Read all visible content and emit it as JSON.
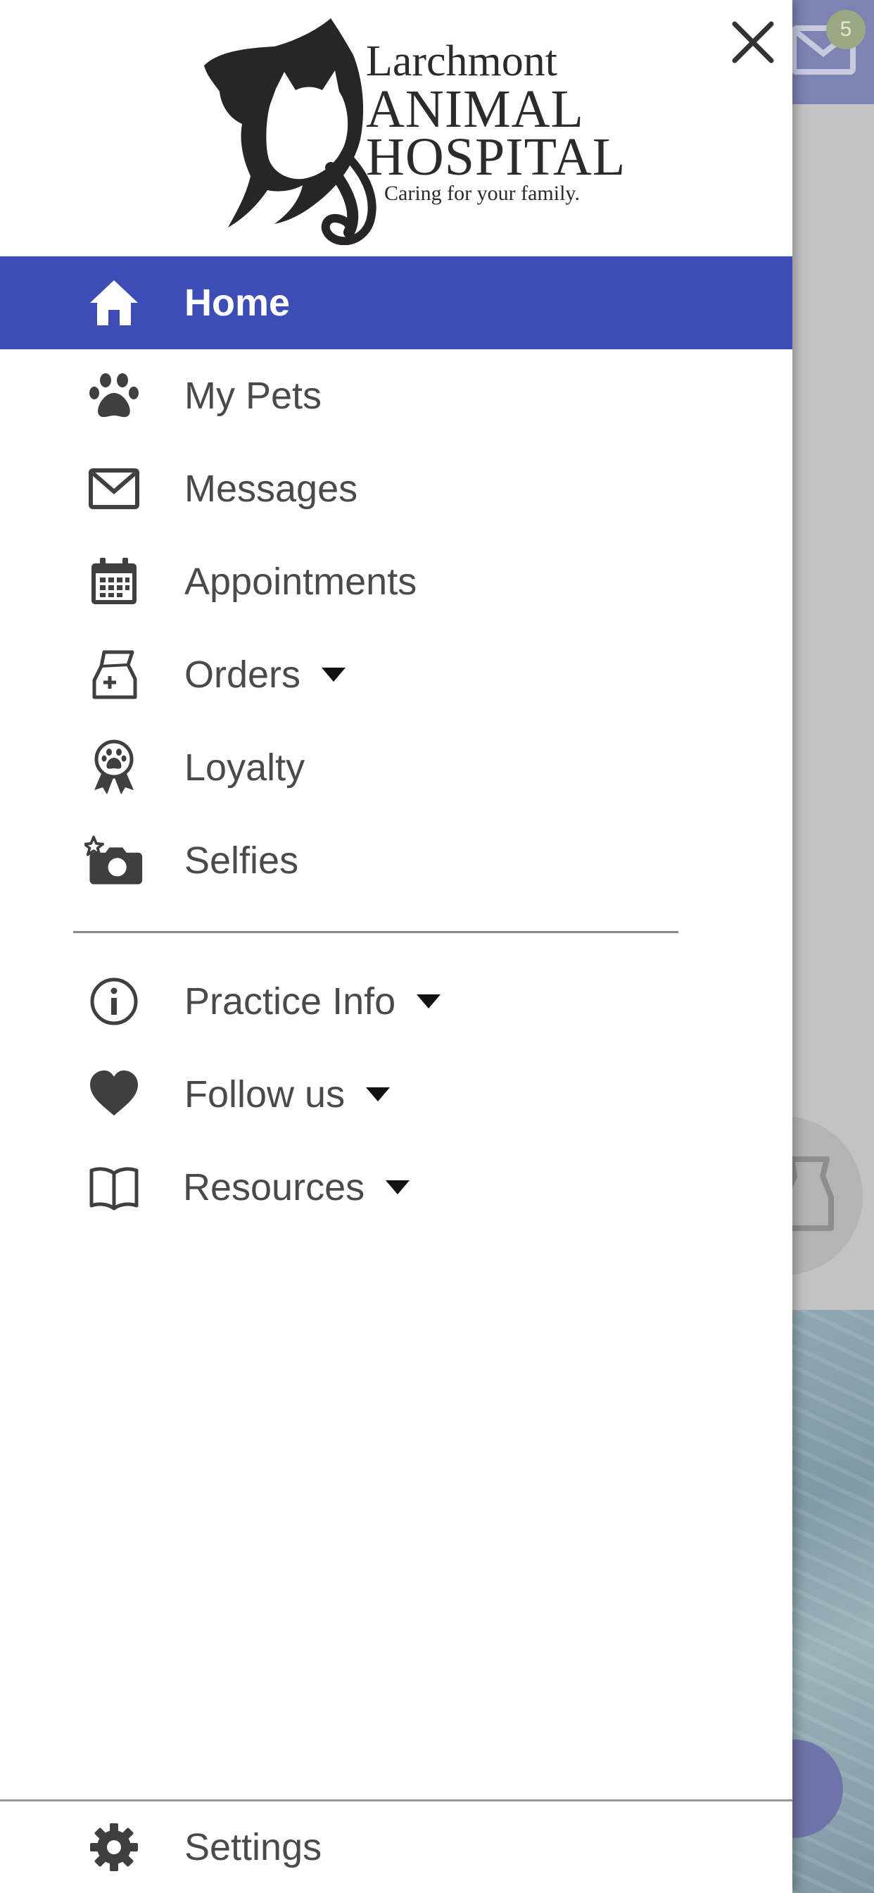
{
  "background": {
    "unread_badge": "5"
  },
  "drawer": {
    "logo": {
      "line1": "Larchmont",
      "line2": "ANIMAL",
      "line3": "HOSPITAL",
      "tagline": "Caring for your family."
    },
    "items": [
      {
        "label": "Home",
        "icon": "home-icon",
        "active": true
      },
      {
        "label": "My Pets",
        "icon": "paw-icon"
      },
      {
        "label": "Messages",
        "icon": "envelope-icon"
      },
      {
        "label": "Appointments",
        "icon": "calendar-icon"
      },
      {
        "label": "Orders",
        "icon": "medicine-bag-icon",
        "expandable": true
      },
      {
        "label": "Loyalty",
        "icon": "award-ribbon-icon"
      },
      {
        "label": "Selfies",
        "icon": "camera-star-icon"
      }
    ],
    "secondary_items": [
      {
        "label": "Practice Info",
        "icon": "info-icon",
        "expandable": true
      },
      {
        "label": "Follow us",
        "icon": "heart-icon",
        "expandable": true
      },
      {
        "label": "Resources",
        "icon": "book-icon",
        "expandable": true
      }
    ],
    "footer": {
      "label": "Settings",
      "icon": "gear-icon"
    }
  },
  "colors": {
    "active_bg": "#3d4db5",
    "text": "#4a4a4a",
    "icon": "#3f3f3f"
  }
}
